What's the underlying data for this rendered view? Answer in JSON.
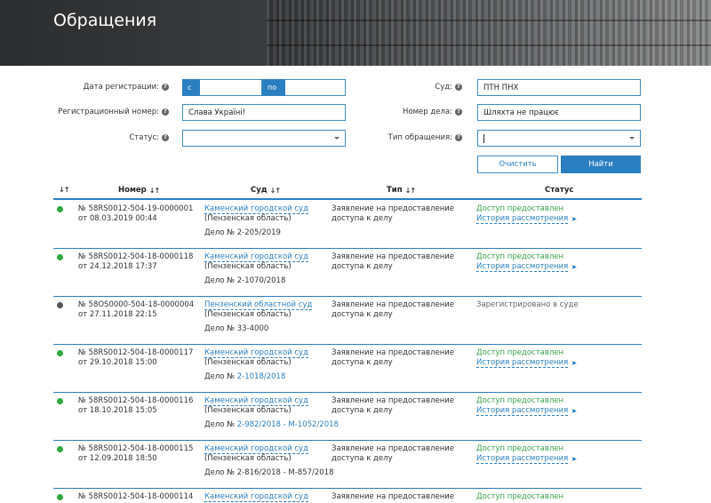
{
  "header": {
    "title": "Обращения"
  },
  "colors": {
    "accent": "#2b7fc0",
    "status_ok": "#3aa14d",
    "status_pending": "#666666",
    "dot_green": "#2fa83f",
    "dot_grey": "#555555"
  },
  "filters": {
    "reg_date": {
      "label": "Дата регистрации:",
      "from_label": "с",
      "to_label": "по",
      "from_value": "",
      "to_value": ""
    },
    "reg_number": {
      "label": "Регистрационный номер:",
      "value": "Слава Україні!"
    },
    "status": {
      "label": "Статус:",
      "value": ""
    },
    "court": {
      "label": "Суд:",
      "value": "ПТН ПНХ"
    },
    "case_number": {
      "label": "Номер дела:",
      "value": "Шляхта не працює"
    },
    "appeal_type": {
      "label": "Тип обращения:",
      "value": ""
    },
    "help_icon": "question-circle-icon",
    "clear_label": "Очистить",
    "find_label": "Найти"
  },
  "table": {
    "headers": {
      "number": "Номер",
      "court": "Суд",
      "type": "Тип",
      "status": "Статус"
    },
    "rows": [
      {
        "dot": "green",
        "number": "№ 58RS0012-504-19-0000001",
        "date": "от 08.03.2019 00:44",
        "court": "Каменский городской суд",
        "region": "(Пензенская область)",
        "case_prefix": "Дело № ",
        "case": "2-205/2019",
        "case_is_link": false,
        "type": "Заявление на предоставление доступа к делу",
        "status": "Доступ предоставлен",
        "status_kind": "ok",
        "history": "История рассмотрения"
      },
      {
        "dot": "green",
        "number": "№ 58RS0012-504-18-0000118",
        "date": "от 24.12.2018 17:37",
        "court": "Каменский городской суд",
        "region": "(Пензенская область)",
        "case_prefix": "Дело № ",
        "case": "2-1070/2018",
        "case_is_link": false,
        "type": "Заявление на предоставление доступа к делу",
        "status": "Доступ предоставлен",
        "status_kind": "ok",
        "history": "История рассмотрения"
      },
      {
        "dot": "grey",
        "number": "№ 58OS0000-504-18-0000004",
        "date": "от 27.11.2018 22:15",
        "court": "Пензенский областной суд",
        "region": "(Пензенская область)",
        "case_prefix": "Дело № ",
        "case": "33-4000",
        "case_is_link": false,
        "type": "Заявление на предоставление доступа к делу",
        "status": "Зарегистрировано в суде",
        "status_kind": "pending",
        "history": ""
      },
      {
        "dot": "green",
        "number": "№ 58RS0012-504-18-0000117",
        "date": "от 29.10.2018 15:00",
        "court": "Каменский городской суд",
        "region": "(Пензенская область)",
        "case_prefix": "Дело № ",
        "case": "2-1018/2018",
        "case_is_link": true,
        "type": "Заявление на предоставление доступа к делу",
        "status": "Доступ предоставлен",
        "status_kind": "ok",
        "history": "История рассмотрения"
      },
      {
        "dot": "green",
        "number": "№ 58RS0012-504-18-0000116",
        "date": "от 18.10.2018 15:05",
        "court": "Каменский городской суд",
        "region": "(Пензенская область)",
        "case_prefix": "Дело № ",
        "case": "2-982/2018 - М-1052/2018",
        "case_is_link": true,
        "type": "Заявление на предоставление доступа к делу",
        "status": "Доступ предоставлен",
        "status_kind": "ok",
        "history": "История рассмотрения"
      },
      {
        "dot": "green",
        "number": "№ 58RS0012-504-18-0000115",
        "date": "от 12.09.2018 18:50",
        "court": "Каменский городской суд",
        "region": "(Пензенская область)",
        "case_prefix": "Дело № ",
        "case": "2-816/2018 - М-857/2018",
        "case_is_link": false,
        "type": "Заявление на предоставление доступа к делу",
        "status": "Доступ предоставлен",
        "status_kind": "ok",
        "history": "История рассмотрения"
      },
      {
        "dot": "green",
        "number": "№ 58RS0012-504-18-0000114",
        "date": "",
        "court": "Каменский городской суд",
        "region": "",
        "case_prefix": "",
        "case": "",
        "case_is_link": false,
        "type": "Заявление на предоставление доступа",
        "status": "Доступ предоставлен",
        "status_kind": "ok",
        "history": ""
      }
    ]
  }
}
